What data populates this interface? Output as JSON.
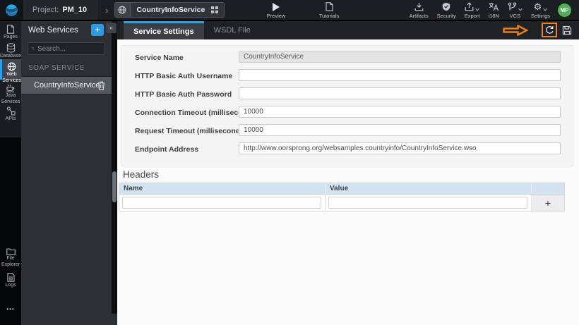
{
  "topbar": {
    "project_label": "Project:",
    "project_name": "PM_10",
    "service_tab_label": "CountryInfoService",
    "preview_label": "Preview",
    "tutorials_label": "Tutorials",
    "artifacts_label": "Artifacts",
    "security_label": "Security",
    "export_label": "Export",
    "i18n_label": "i18N",
    "vcs_label": "VCS",
    "settings_label": "Settings",
    "avatar_initials": "MP"
  },
  "rail": {
    "items": [
      {
        "label": "Pages"
      },
      {
        "label": "Databases"
      },
      {
        "label": "Web Services"
      },
      {
        "label": "Java Services"
      },
      {
        "label": "APIs"
      },
      {
        "label": "File Explorer"
      },
      {
        "label": "Logs"
      },
      {
        "label": "•••"
      }
    ]
  },
  "sidebar": {
    "title": "Web Services",
    "add_button_label": "+",
    "search_placeholder": "Search...",
    "section_label": "SOAP SERVICE",
    "service_name": "CountryInfoService",
    "collapse_glyph": "«"
  },
  "main": {
    "tabs": [
      {
        "label": "Service Settings"
      },
      {
        "label": "WSDL File"
      }
    ],
    "form": {
      "fields": [
        {
          "label": "Service Name",
          "value": "CountryInfoService"
        },
        {
          "label": "HTTP Basic Auth Username",
          "value": ""
        },
        {
          "label": "HTTP Basic Auth Password",
          "value": ""
        },
        {
          "label": "Connection Timeout (milliseconds)",
          "value": "10000"
        },
        {
          "label": "Request Timeout (milliseconds)",
          "value": "10000"
        },
        {
          "label": "Endpoint Address",
          "value": "http://www.oorsprong.org/websamples.countryinfo/CountryInfoService.wso"
        }
      ]
    },
    "headers": {
      "title": "Headers",
      "columns": [
        "Name",
        "Value"
      ],
      "add_button_label": "+"
    }
  },
  "colors": {
    "accent_blue": "#2E9FE6",
    "annotation_orange": "#EE7F1D",
    "avatar_green": "#4FAF52",
    "table_header_blue": "#D2E2F0"
  }
}
